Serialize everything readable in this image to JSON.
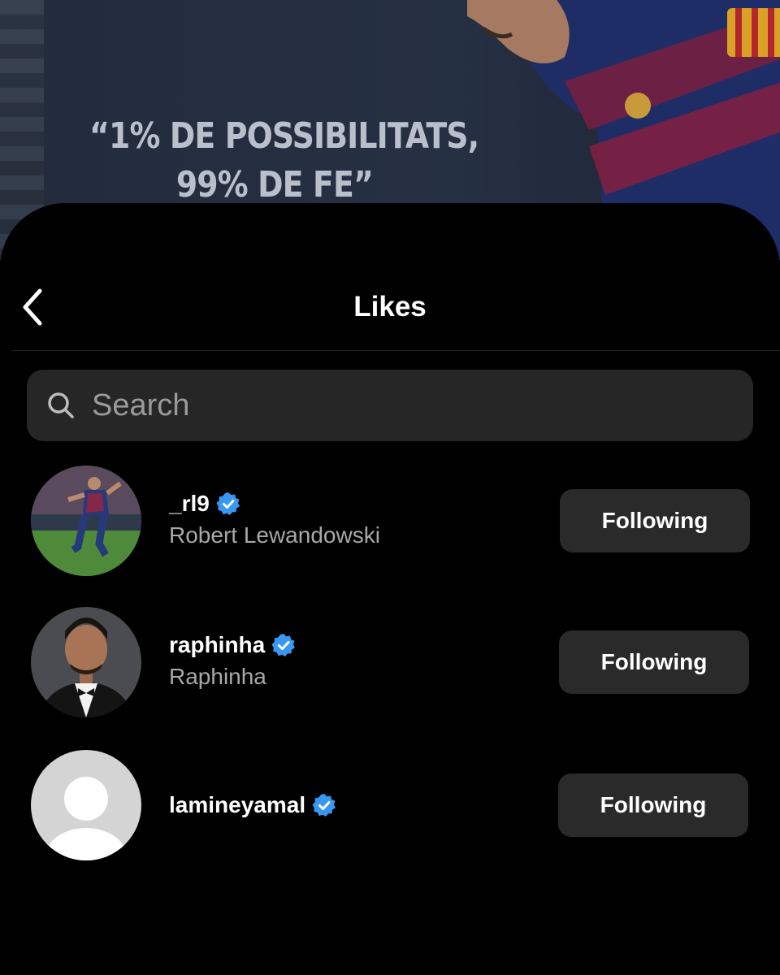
{
  "background_post": {
    "quote_line_1": "“1% DE POSSIBILITATS,",
    "quote_line_2": "99% DE FE”"
  },
  "header": {
    "title": "Likes",
    "back_icon": "chevron-left-icon"
  },
  "search": {
    "placeholder": "Search",
    "icon": "search-icon"
  },
  "likes": [
    {
      "username": "_rl9",
      "full_name": "Robert Lewandowski",
      "verified": true,
      "button_label": "Following"
    },
    {
      "username": "raphinha",
      "full_name": "Raphinha",
      "verified": true,
      "button_label": "Following"
    },
    {
      "username": "lamineyamal",
      "full_name": "",
      "verified": true,
      "button_label": "Following"
    }
  ],
  "colors": {
    "background": "#000000",
    "search_field": "#262626",
    "button": "#2a2a2a",
    "verified_badge": "#3897f0",
    "secondary_text": "#a8a8a8"
  }
}
